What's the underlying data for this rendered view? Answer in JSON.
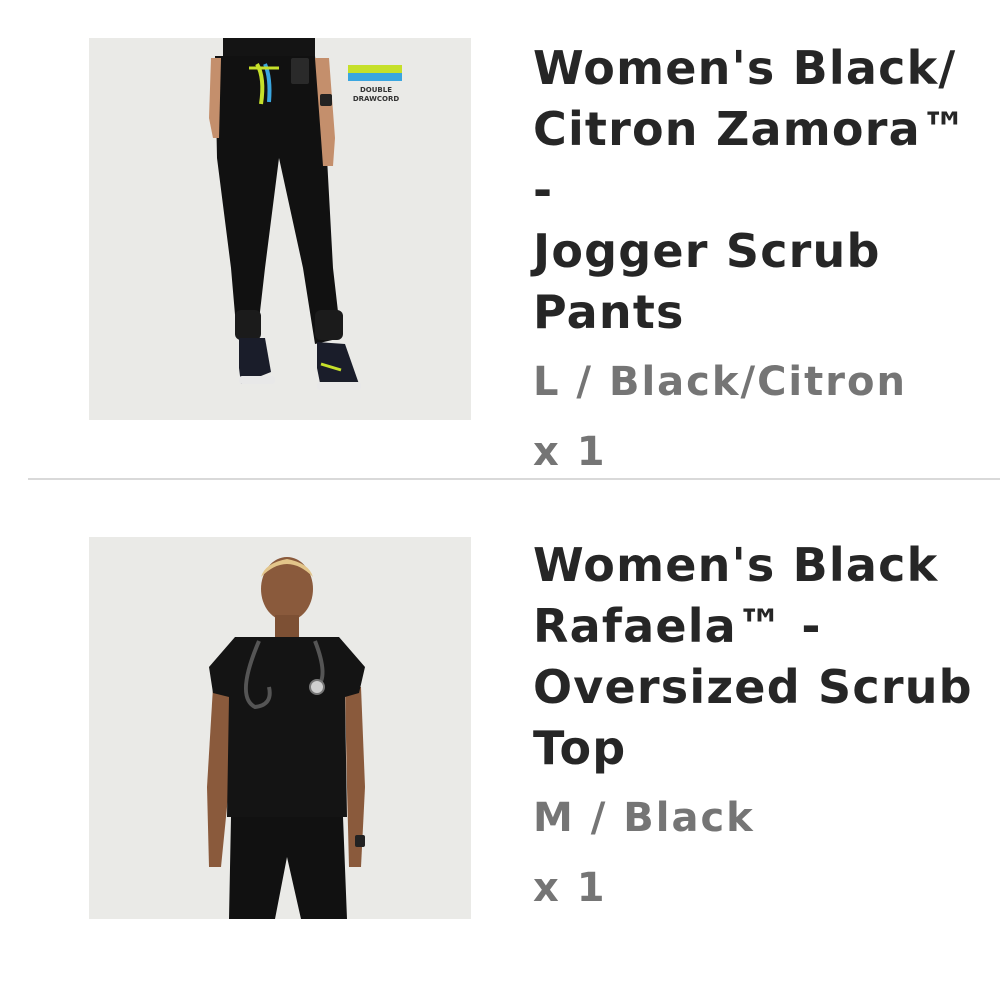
{
  "items": [
    {
      "title": "Women's Black/\nCitron Zamora™ -\nJogger Scrub\nPants",
      "variant": "L / Black/Citron",
      "quantity": "x 1",
      "image_badge": [
        "DOUBLE",
        "DRAWCORD"
      ],
      "badge_colors": [
        "#3aa6e0",
        "#c6e02a"
      ]
    },
    {
      "title": "Women's Black\nRafaela™ -\nOversized Scrub\nTop",
      "variant": "M / Black",
      "quantity": "x 1"
    }
  ]
}
